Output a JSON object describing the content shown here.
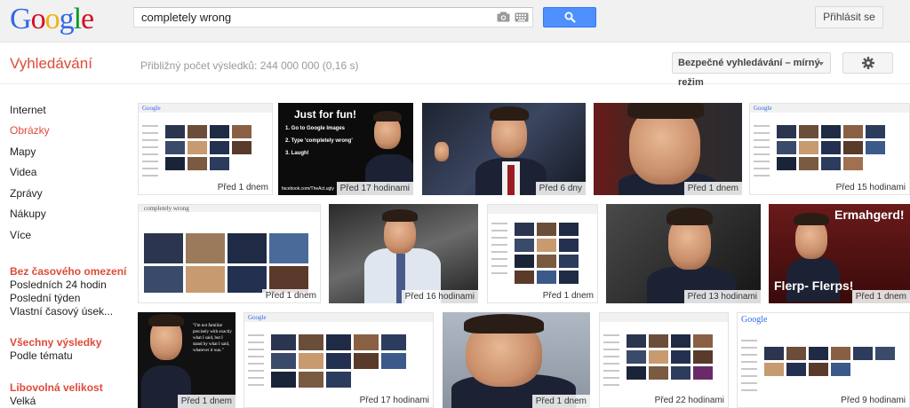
{
  "header": {
    "logo_letters": [
      {
        "ch": "G",
        "color": "#3369e8"
      },
      {
        "ch": "o",
        "color": "#d50f25"
      },
      {
        "ch": "o",
        "color": "#eeb211"
      },
      {
        "ch": "g",
        "color": "#3369e8"
      },
      {
        "ch": "l",
        "color": "#009925"
      },
      {
        "ch": "e",
        "color": "#d50f25"
      }
    ],
    "search_value": "completely wrong",
    "signin_label": "Přihlásit se"
  },
  "subbar": {
    "section_title": "Vyhledávání",
    "result_stats": "Přibližný počet výsledků: 244 000 000 (0,16 s)",
    "safesearch_label": "Bezpečné vyhledávání – mírný režim"
  },
  "nav": {
    "types": [
      "Internet",
      "Obrázky",
      "Mapy",
      "Videa",
      "Zprávy",
      "Nákupy",
      "Více"
    ],
    "active_type": "Obrázky",
    "time": {
      "heading": "Bez časového omezení",
      "options": [
        "Posledních 24 hodin",
        "Poslední týden",
        "Vlastní časový úsek..."
      ]
    },
    "results": {
      "heading": "Všechny výsledky",
      "options": [
        "Podle tématu"
      ]
    },
    "size": {
      "heading": "Libovolná velikost",
      "options": [
        "Velká"
      ]
    }
  },
  "images": {
    "row1": [
      "Před 1 dnem",
      "Před 17 hodinami",
      "Před 6 dny",
      "Před 1 dnem",
      "Před 15 hodinami"
    ],
    "row2": [
      "Před 1 dnem",
      "Před 16 hodinami",
      "Před 1 dnem",
      "Před 13 hodinami",
      "Před 1 dnem"
    ],
    "row3": [
      "Před 1 dnem",
      "Před 17 hodinami",
      "Před 1 dnem",
      "Před 22 hodinami",
      "Před 9 hodinami"
    ],
    "meme1_title": "Just for fun!",
    "meme1_steps": [
      "1. Go to Google Images",
      "2. Type 'completely wrong'",
      "3. Laugh!"
    ],
    "meme1_footer": "facebook.com/TheAct.ugly",
    "meme2_top": "Ermahgerd!",
    "meme2_bottom": "Flerp- Flerps!",
    "mini_search": "completely wrong",
    "quote": "\"I'm not familiar precisely with exactly what I said, but I stand by what I said, whatever it was.\""
  },
  "colors": {
    "accent_red": "#dd4b39",
    "search_blue": "#4d90fe"
  }
}
